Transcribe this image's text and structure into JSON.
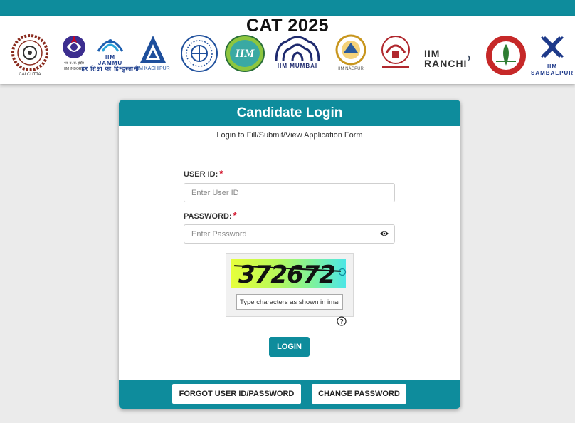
{
  "header": {
    "title": "CAT 2025",
    "logos": [
      {
        "id": "iim-calcutta",
        "text": "CALCUTTA"
      },
      {
        "id": "iim-indore",
        "text": "भा. प्र. सं. इंदौर\nIIM INDORE"
      },
      {
        "id": "iim-jammu",
        "text": "IIM\nJAMMU\nहर शिक्षा का हिन्दुस्तानी"
      },
      {
        "id": "iim-kashipur",
        "text": "IIM KASHIPUR"
      },
      {
        "id": "iim-bangalore",
        "text": ""
      },
      {
        "id": "iim-lucknow",
        "text": "IIM\nLUCKNOW"
      },
      {
        "id": "iim-mumbai",
        "text": "IIM MUMBAI"
      },
      {
        "id": "iim-nagpur",
        "text": "IIM NAGPUR"
      },
      {
        "id": "iim-kozhikode",
        "text": ""
      },
      {
        "id": "iim-ranchi",
        "text": "IIM\nRANCHI"
      },
      {
        "id": "iim-rohtak",
        "text": ""
      },
      {
        "id": "iim-sambalpur",
        "text": "IIM\nSAMBALPUR"
      }
    ]
  },
  "login": {
    "title": "Candidate Login",
    "subtitle": "Login to Fill/Submit/View Application Form",
    "user_id_label": "USER ID:",
    "user_id_placeholder": "Enter User ID",
    "password_label": "PASSWORD:",
    "password_placeholder": "Enter Password",
    "required_marker": "*",
    "captcha_text": "372672",
    "captcha_placeholder": "Type characters as shown in image",
    "login_button": "LOGIN",
    "forgot_button": "FORGOT USER ID/PASSWORD",
    "change_password_button": "CHANGE PASSWORD"
  },
  "colors": {
    "primary": "#0e8c9c",
    "required": "#d0021b"
  },
  "icons": {
    "password_toggle": "eye-icon",
    "captcha_refresh": "refresh-icon",
    "captcha_help": "help-icon"
  }
}
